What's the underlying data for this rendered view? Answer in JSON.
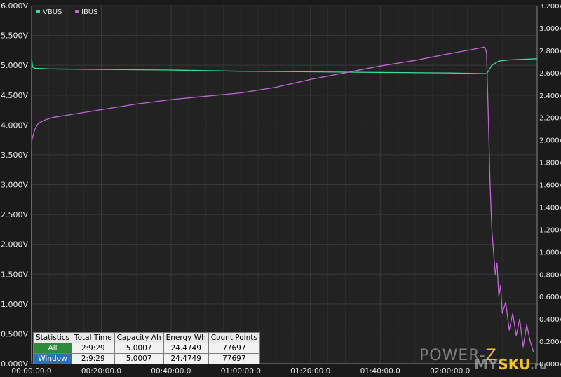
{
  "chart_data": {
    "type": "line",
    "x_tick_labels": [
      "00:00:00.0",
      "00:20:00.0",
      "00:40:00.0",
      "01:00:00.0",
      "01:20:00.0",
      "01:40:00.0",
      "02:00:00.0"
    ],
    "x_tick_minutes": [
      0,
      20,
      40,
      60,
      80,
      100,
      120
    ],
    "xlim": [
      0,
      145
    ],
    "y_left": {
      "lim": [
        0,
        6
      ],
      "ticks": [
        "0.000V",
        "0.500V",
        "1.000V",
        "1.500V",
        "2.000V",
        "2.500V",
        "3.000V",
        "3.500V",
        "4.000V",
        "4.500V",
        "5.000V",
        "5.500V",
        "6.000V"
      ]
    },
    "y_right": {
      "lim": [
        0,
        3.2
      ],
      "ticks": [
        "0.000A",
        "0.200A",
        "0.400A",
        "0.600A",
        "0.800A",
        "1.000A",
        "1.200A",
        "1.400A",
        "1.600A",
        "1.800A",
        "2.000A",
        "2.200A",
        "2.400A",
        "2.600A",
        "2.800A",
        "3.000A",
        "3.200A"
      ]
    },
    "grid": true,
    "legend_position": "top-left",
    "series": [
      {
        "name": "VBUS",
        "axis": "left",
        "color": "#3ddc9a",
        "x": [
          0,
          0.05,
          0.3,
          1,
          5,
          20,
          40,
          60,
          80,
          100,
          120,
          130.5,
          131,
          132,
          134,
          137,
          145
        ],
        "y": [
          0.05,
          5.1,
          4.97,
          4.95,
          4.94,
          4.93,
          4.92,
          4.9,
          4.89,
          4.88,
          4.87,
          4.86,
          4.9,
          5.0,
          5.07,
          5.09,
          5.11
        ]
      },
      {
        "name": "IBUS",
        "axis": "right",
        "color": "#c266d6",
        "x": [
          0,
          0.1,
          1,
          2,
          4,
          6,
          10,
          20,
          30,
          40,
          50,
          60,
          70,
          80,
          90,
          100,
          110,
          118,
          125,
          130,
          130.5,
          131,
          131.5,
          132,
          132.5,
          133,
          133.5,
          134,
          134.5,
          135,
          136,
          137,
          138,
          139,
          140,
          141,
          142,
          143,
          144
        ],
        "y": [
          1.9,
          2.0,
          2.1,
          2.15,
          2.18,
          2.2,
          2.22,
          2.27,
          2.32,
          2.36,
          2.39,
          2.42,
          2.47,
          2.54,
          2.6,
          2.66,
          2.71,
          2.76,
          2.8,
          2.83,
          2.78,
          2.2,
          1.6,
          1.2,
          1.0,
          0.8,
          0.9,
          0.6,
          0.7,
          0.45,
          0.55,
          0.3,
          0.45,
          0.25,
          0.4,
          0.15,
          0.35,
          0.2,
          0.1
        ]
      }
    ]
  },
  "stats_table": {
    "headers": [
      "Statistics",
      "Total Time",
      "Capacity Ah",
      "Energy Wh",
      "Count Points"
    ],
    "all": {
      "label": "All",
      "total_time": "2:9:29",
      "capacity": "5.0007",
      "energy": "24.4749",
      "count": "77697"
    },
    "window": {
      "label": "Window",
      "total_time": "2:9:29",
      "capacity": "5.0007",
      "energy": "24.4749",
      "count": "77697"
    }
  },
  "watermark": {
    "line1_left": "POWER-",
    "line1_accent": "Z",
    "line2_left": "MY",
    "line2_accent": "SKU",
    "line2_suffix": ".ru"
  },
  "colors": {
    "background": "#1a1a1a",
    "grid": "#3a3a3a",
    "axis_text": "#e6e6e6",
    "vbus": "#3ddc9a",
    "ibus": "#c266d6"
  }
}
